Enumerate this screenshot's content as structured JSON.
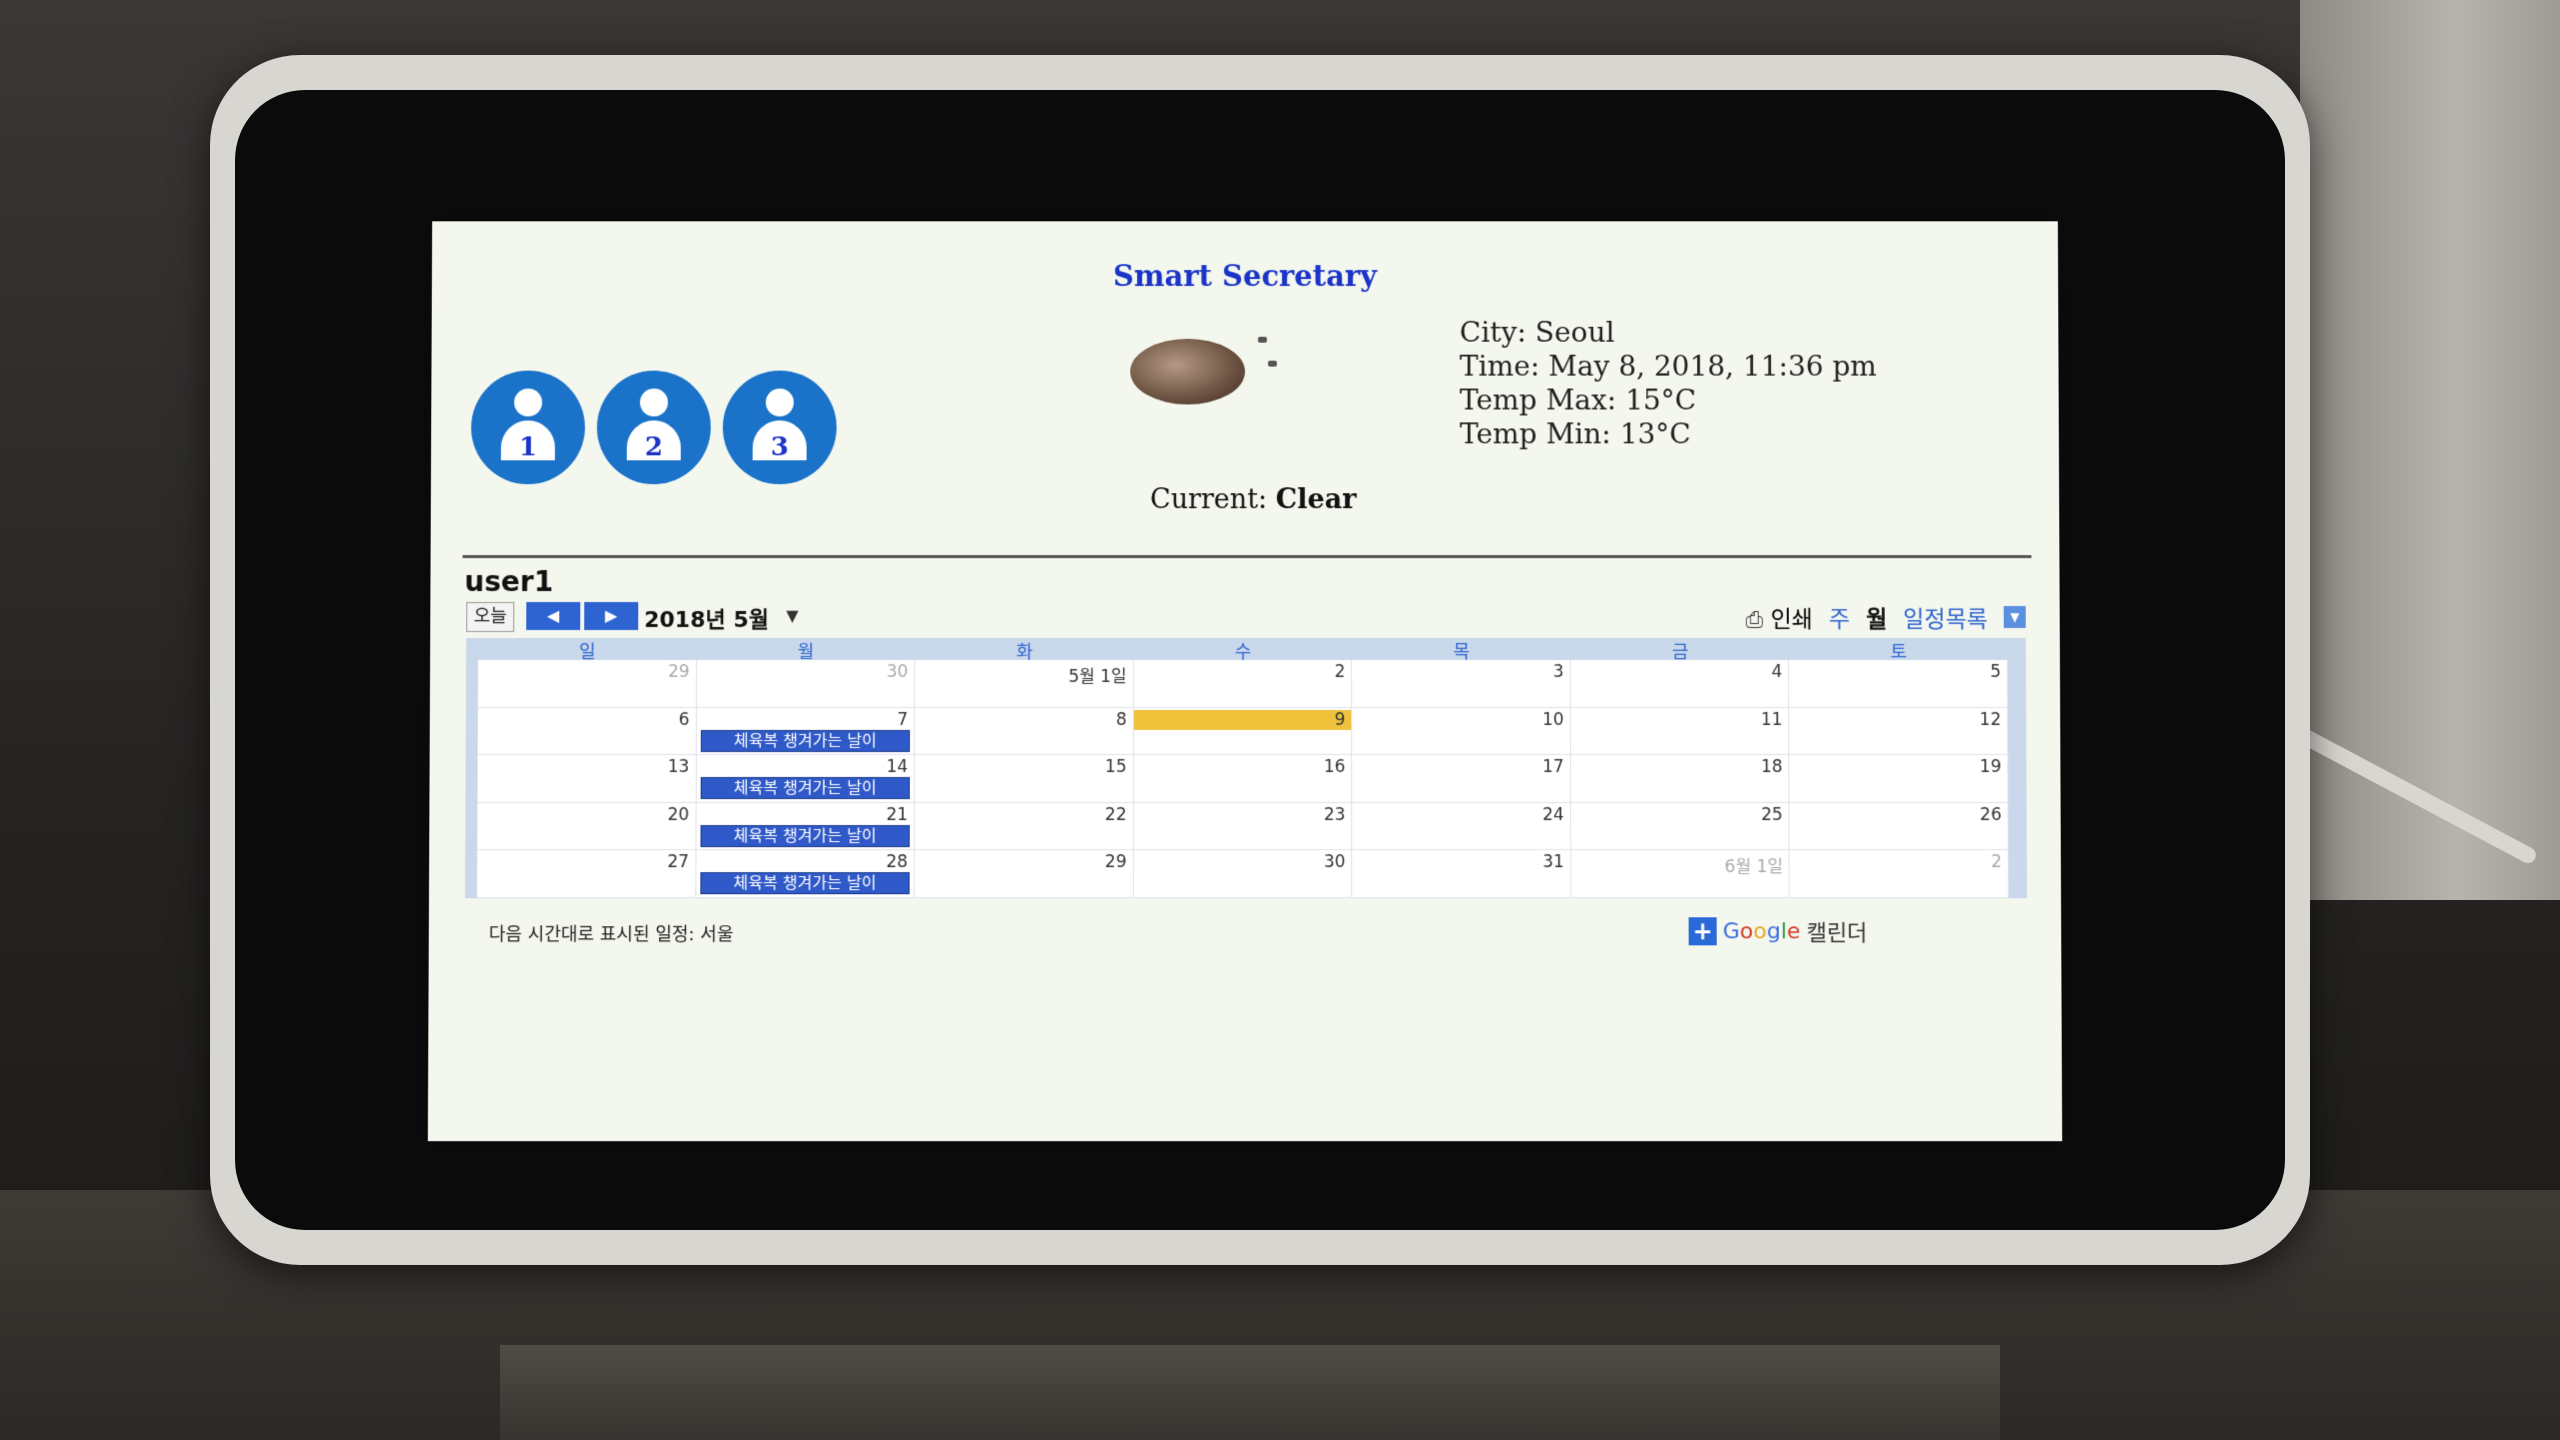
{
  "app": {
    "title": "Smart Secretary"
  },
  "users": [
    {
      "number": "1",
      "icon": "user-icon"
    },
    {
      "number": "2",
      "icon": "user-icon"
    },
    {
      "number": "3",
      "icon": "user-icon"
    }
  ],
  "weather": {
    "icon": "moon-clear-night-icon",
    "current_label": "Current:",
    "current_value": "Clear",
    "city": "City: Seoul",
    "time": "Time: May 8, 2018, 11:36 pm",
    "temp_max": "Temp Max: 15°C",
    "temp_min": "Temp Min: 13°C"
  },
  "calendar": {
    "user": "user1",
    "today_button": "오늘",
    "prev_icon": "◀",
    "next_icon": "▶",
    "month_label": "2018년 5월",
    "print_label": "인쇄",
    "view_week": "주",
    "view_month": "월",
    "view_agenda": "일정목록",
    "weekdays": [
      "일",
      "월",
      "화",
      "수",
      "목",
      "금",
      "토"
    ],
    "event_title": "체육복 챙겨가는 날이",
    "timezone_note": "다음 시간대로 표시된 일정: 서울",
    "gcal_brand": [
      "G",
      "o",
      "o",
      "g",
      "l",
      "e"
    ],
    "gcal_word": "캘린더",
    "weeks": [
      [
        "29",
        "30",
        "5월 1일",
        "2",
        "3",
        "4",
        "5"
      ],
      [
        "6",
        "7",
        "8",
        "9",
        "10",
        "11",
        "12"
      ],
      [
        "13",
        "14",
        "15",
        "16",
        "17",
        "18",
        "19"
      ],
      [
        "20",
        "21",
        "22",
        "23",
        "24",
        "25",
        "26"
      ],
      [
        "27",
        "28",
        "29",
        "30",
        "31",
        "6월 1일",
        "2"
      ]
    ]
  },
  "colors": {
    "accent": "#2e64d2",
    "title": "#1a33c8",
    "today_highlight": "#eec23a",
    "event": "#2f59c8"
  }
}
